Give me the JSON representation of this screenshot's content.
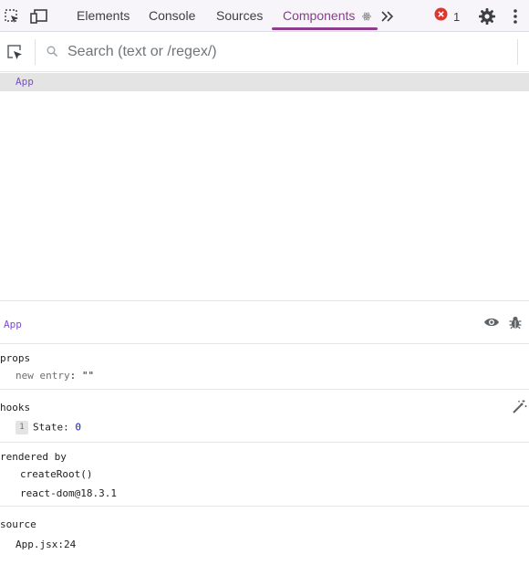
{
  "tabs": [
    {
      "label": "Elements",
      "active": false
    },
    {
      "label": "Console",
      "active": false
    },
    {
      "label": "Sources",
      "active": false
    },
    {
      "label": "Components",
      "active": true
    }
  ],
  "error_count": "1",
  "search": {
    "placeholder": "Search (text or /regex/)",
    "value": ""
  },
  "tree": {
    "selected_label": "App"
  },
  "inspected": {
    "component_name": "App",
    "props": {
      "title": "props",
      "items": [
        {
          "key": "new entry",
          "value": "\"\""
        }
      ]
    },
    "hooks": {
      "title": "hooks",
      "items": [
        {
          "index": "1",
          "key": "State",
          "value": "0"
        }
      ]
    },
    "rendered_by": {
      "title": "rendered by",
      "items": [
        "createRoot()",
        "react-dom@18.3.1"
      ]
    },
    "source": {
      "title": "source",
      "location": "App.jsx:24"
    }
  },
  "colors": {
    "accent": "#8a3e8c",
    "component_name": "#7a4fc7",
    "error": "#dc362e",
    "number": "#1a1aa6"
  },
  "icons": {
    "select-element": "dashed-square-cursor-icon",
    "device-toolbar": "device-icon",
    "more-tabs": "chevron-double-right-icon",
    "error": "error-circle-icon",
    "settings": "gear-icon",
    "menu": "kebab-menu-icon",
    "inspect": "inspect-cursor-icon",
    "search": "search-icon",
    "view-source": "eye-icon",
    "log": "bug-icon",
    "edit-hooks": "magic-wand-icon"
  }
}
